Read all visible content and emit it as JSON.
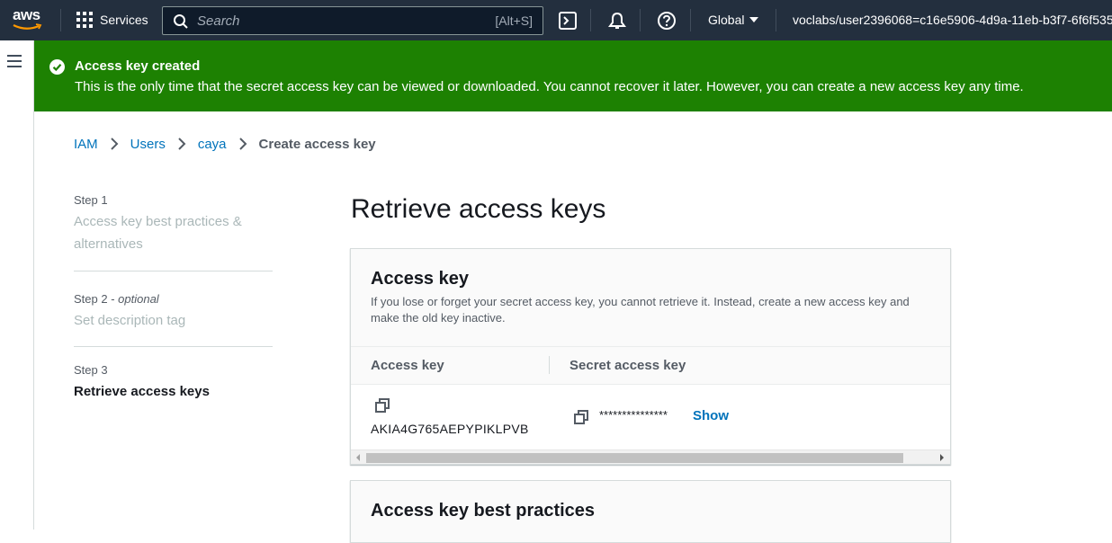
{
  "nav": {
    "logo_text": "aws",
    "services_label": "Services",
    "search_placeholder": "Search",
    "search_shortcut": "[Alt+S]",
    "region_label": "Global",
    "account_label": "voclabs/user2396068=c16e5906-4d9a-11eb-b3f7-6f6f535"
  },
  "flash": {
    "title": "Access key created",
    "message": "This is the only time that the secret access key can be viewed or downloaded. You cannot recover it later. However, you can create a new access key any time.",
    "color": "#1d8102"
  },
  "breadcrumb": {
    "items": [
      "IAM",
      "Users",
      "caya"
    ],
    "current": "Create access key"
  },
  "steps": [
    {
      "label": "Step 1",
      "title": "Access key best practices & alternatives"
    },
    {
      "label": "Step 2",
      "optional": "optional",
      "title": "Set description tag"
    },
    {
      "label": "Step 3",
      "title": "Retrieve access keys"
    }
  ],
  "page_title": "Retrieve access keys",
  "access_key_panel": {
    "title": "Access key",
    "description": "If you lose or forget your secret access key, you cannot retrieve it. Instead, create a new access key and make the old key inactive.",
    "columns": [
      "Access key",
      "Secret access key"
    ],
    "row": {
      "access_key": "AKIA4G765AEPYPIKLPVB",
      "secret_masked": "***************",
      "show_label": "Show"
    }
  },
  "best_practices_panel": {
    "title": "Access key best practices"
  },
  "icons": [
    "grid-icon",
    "search-icon",
    "cloudshell-icon",
    "bell-icon",
    "help-icon",
    "caret-down-icon",
    "hamburger-icon",
    "check-circle-icon",
    "chevron-right-icon",
    "copy-icon"
  ]
}
